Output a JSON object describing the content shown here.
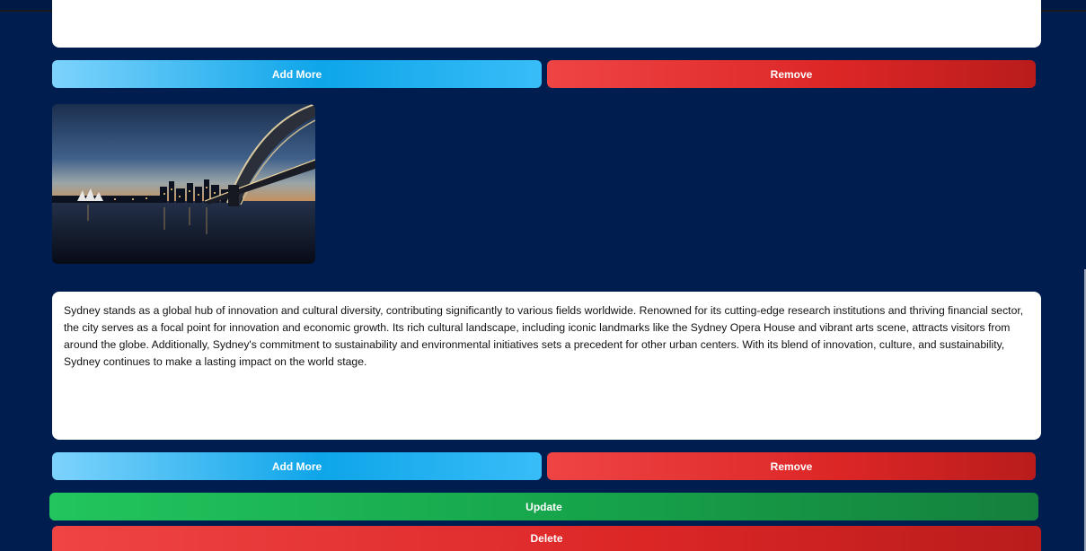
{
  "section1": {
    "add_more_label": "Add More",
    "remove_label": "Remove"
  },
  "section2": {
    "description": "Sydney stands as a global hub of innovation and cultural diversity, contributing significantly to various fields worldwide. Renowned for its cutting-edge research institutions and thriving financial sector, the city serves as a focal point for innovation and economic growth. Its rich cultural landscape, including iconic landmarks like the Sydney Opera House and vibrant arts scene, attracts visitors from around the globe. Additionally, Sydney's commitment to sustainability and environmental initiatives sets a precedent for other urban centers. With its blend of innovation, culture, and sustainability, Sydney continues to make a lasting impact on the world stage.",
    "add_more_label": "Add More",
    "remove_label": "Remove"
  },
  "actions": {
    "update_label": "Update",
    "delete_label": "Delete"
  },
  "colors": {
    "background": "#001d50",
    "add_more": "#0ea5e9",
    "remove": "#dc2626",
    "update": "#16a34a",
    "delete": "#dc2626"
  }
}
